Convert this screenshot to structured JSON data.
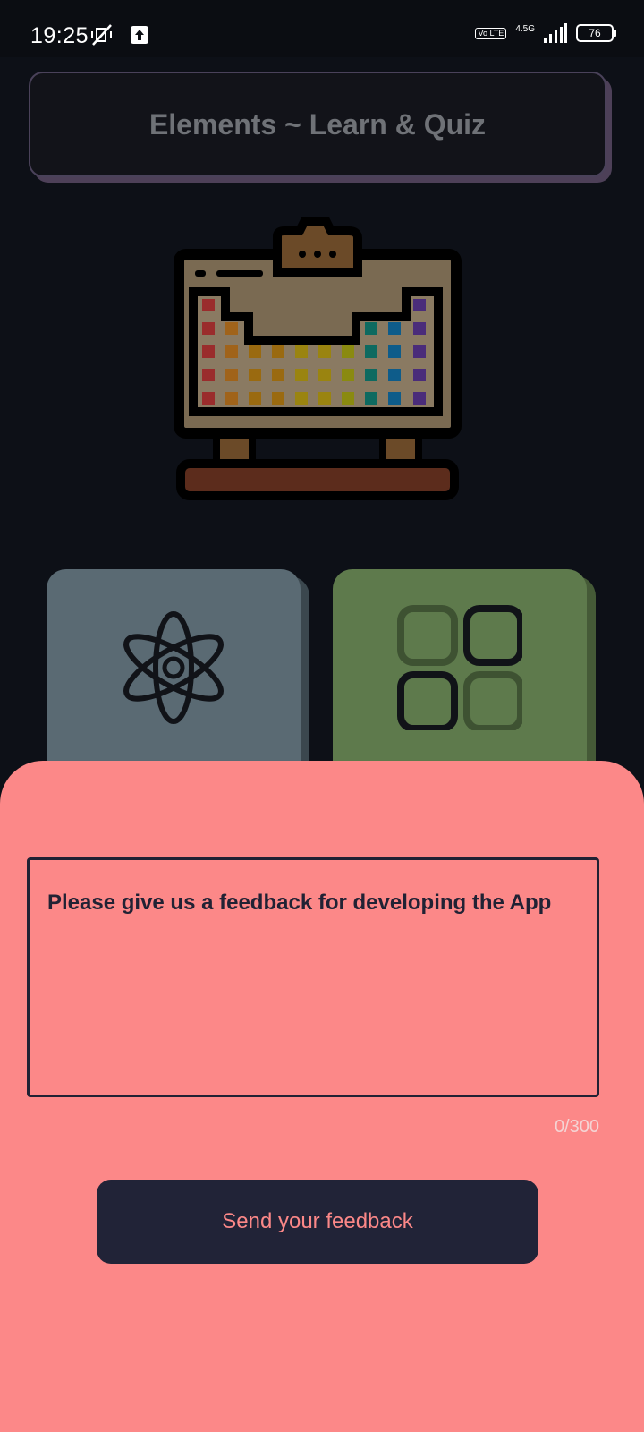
{
  "status_bar": {
    "time": "19:25",
    "volte": "Vo LTE",
    "network": "4.5G",
    "battery": "76"
  },
  "app": {
    "title": "Elements ~ Learn & Quiz"
  },
  "tiles": [
    {
      "icon": "atom-icon"
    },
    {
      "icon": "grid-icon"
    }
  ],
  "feedback": {
    "placeholder": "Please give us a feedback for developing the App",
    "counter": "0/300",
    "send_label": "Send your feedback"
  },
  "colors": {
    "background": "#0d1017",
    "sheet": "#fc8888",
    "button": "#212337",
    "tile_atoms": "#5a6a73",
    "tile_groups": "#5e7a4c"
  }
}
